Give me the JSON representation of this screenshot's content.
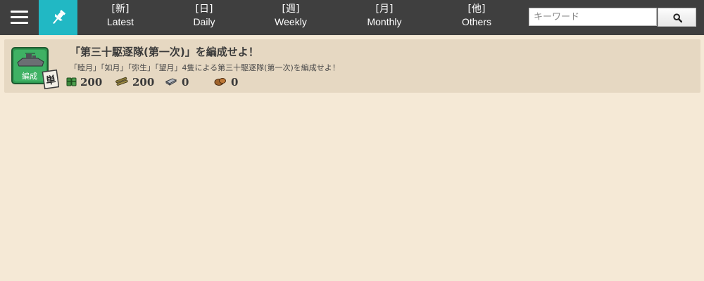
{
  "nav": {
    "tabs": [
      {
        "jp": "[新]",
        "en": "Latest"
      },
      {
        "jp": "[日]",
        "en": "Daily"
      },
      {
        "jp": "[週]",
        "en": "Weekly"
      },
      {
        "jp": "[月]",
        "en": "Monthly"
      },
      {
        "jp": "[他]",
        "en": "Others"
      }
    ],
    "search_placeholder": "キーワード",
    "accent_color": "#21b8c4",
    "bar_color": "#3f3f3f"
  },
  "quest": {
    "icon_label": "編成",
    "badge": "単",
    "title": "「第三十駆逐隊(第一次)」を編成せよ！",
    "description": "「睦月」「如月」「弥生」「望月」4隻による第三十駆逐隊(第一次)を編成せよ！",
    "rewards": {
      "fuel": "200",
      "ammo": "200",
      "steel": "0",
      "bauxite": "0"
    }
  }
}
